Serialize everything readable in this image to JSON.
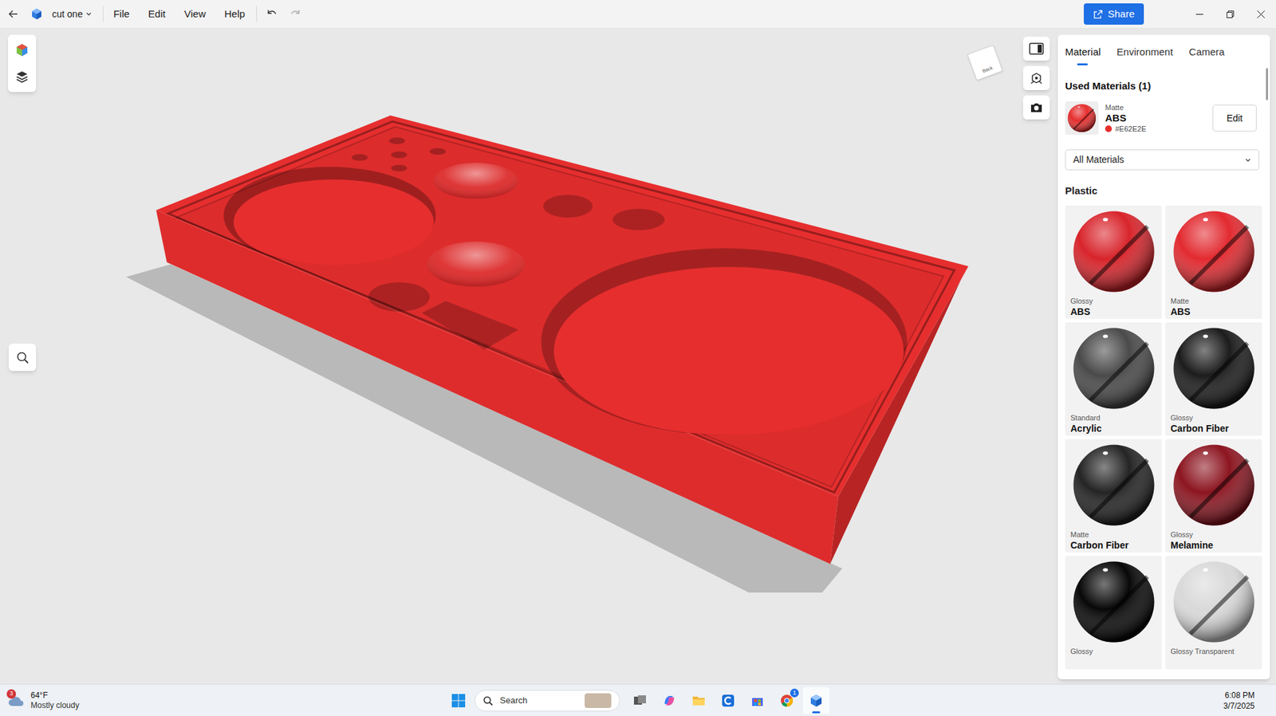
{
  "window": {
    "title": "cut one"
  },
  "menu": [
    "File",
    "Edit",
    "View",
    "Help"
  ],
  "share_button": "Share",
  "view_cube": {
    "label": "Back"
  },
  "panel": {
    "tabs": [
      {
        "label": "Material",
        "selected": true
      },
      {
        "label": "Environment",
        "selected": false
      },
      {
        "label": "Camera",
        "selected": false
      }
    ],
    "used_materials": {
      "heading": "Used Materials (1)",
      "items": [
        {
          "finish": "Matte",
          "name": "ABS",
          "hex": "#E62E2E",
          "color": "#e62e2e",
          "edit": "Edit"
        }
      ]
    },
    "filter": "All Materials",
    "section": "Plastic",
    "materials": [
      {
        "finish": "Glossy",
        "name": "ABS",
        "color": "#d8242b"
      },
      {
        "finish": "Matte",
        "name": "ABS",
        "color": "#e22a30"
      },
      {
        "finish": "Standard",
        "name": "Acrylic",
        "color": "#4a4a4a"
      },
      {
        "finish": "Glossy",
        "name": "Carbon Fiber",
        "color": "#1c1c1c"
      },
      {
        "finish": "Matte",
        "name": "Carbon Fiber",
        "color": "#242424"
      },
      {
        "finish": "Glossy",
        "name": "Melamine",
        "color": "#8c1520"
      },
      {
        "finish": "Glossy",
        "color": "#080808"
      },
      {
        "finish": "Glossy Transparent",
        "color": "#d9d9d9"
      }
    ]
  },
  "taskbar": {
    "weather": {
      "temp": "64°F",
      "condition": "Mostly cloudy",
      "badge": "3"
    },
    "search": "Search",
    "apps": [
      {
        "kind": "taskview",
        "active": false
      },
      {
        "kind": "copilot",
        "active": false
      },
      {
        "kind": "explorer",
        "active": false
      },
      {
        "kind": "capp",
        "active": false
      },
      {
        "kind": "store",
        "active": false
      },
      {
        "kind": "chrome",
        "active": false,
        "badge": "1"
      },
      {
        "kind": "viewer",
        "active": true
      }
    ],
    "time": "6:08 PM",
    "date": "3/7/2025"
  }
}
